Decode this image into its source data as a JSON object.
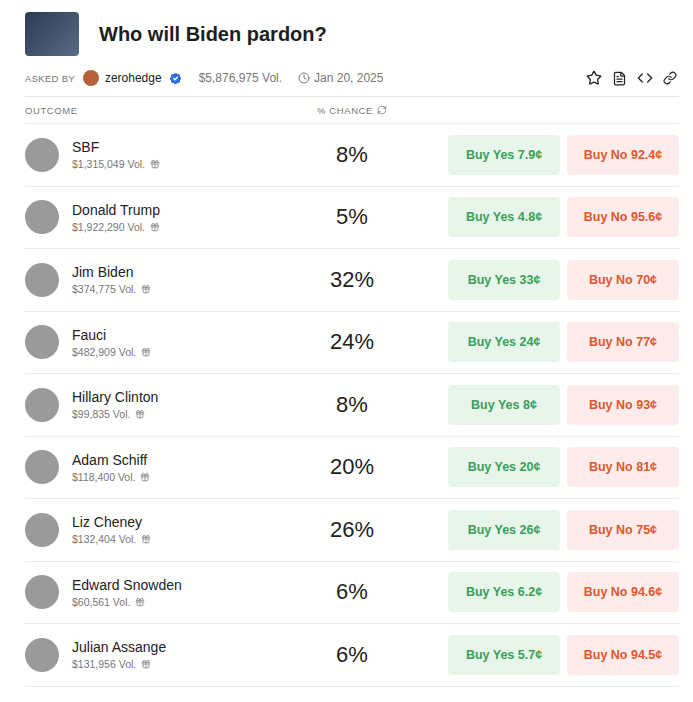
{
  "market": {
    "title": "Who will Biden pardon?",
    "asked_by_label": "ASKED BY",
    "author": "zerohedge",
    "verified": true,
    "volume": "$5,876,975 Vol.",
    "end_date": "Jan 20, 2025"
  },
  "columns": [
    "OUTCOME",
    "% CHANCE"
  ],
  "outcomes": [
    {
      "name": "SBF",
      "volume": "$1,315,049 Vol.",
      "chance": "8%",
      "yes": "Buy Yes 7.9¢",
      "no": "Buy No 92.4¢"
    },
    {
      "name": "Donald Trump",
      "volume": "$1,922,290 Vol.",
      "chance": "5%",
      "yes": "Buy Yes 4.8¢",
      "no": "Buy No 95.6¢"
    },
    {
      "name": "Jim Biden",
      "volume": "$374,775 Vol.",
      "chance": "32%",
      "yes": "Buy Yes 33¢",
      "no": "Buy No 70¢"
    },
    {
      "name": "Fauci",
      "volume": "$482,909 Vol.",
      "chance": "24%",
      "yes": "Buy Yes 24¢",
      "no": "Buy No 77¢"
    },
    {
      "name": "Hillary Clinton",
      "volume": "$99,835 Vol.",
      "chance": "8%",
      "yes": "Buy Yes 8¢",
      "no": "Buy No 93¢"
    },
    {
      "name": "Adam Schiff",
      "volume": "$118,400 Vol.",
      "chance": "20%",
      "yes": "Buy Yes 20¢",
      "no": "Buy No 81¢"
    },
    {
      "name": "Liz Cheney",
      "volume": "$132,404 Vol.",
      "chance": "26%",
      "yes": "Buy Yes 26¢",
      "no": "Buy No 75¢"
    },
    {
      "name": "Edward Snowden",
      "volume": "$60,561 Vol.",
      "chance": "6%",
      "yes": "Buy Yes 6.2¢",
      "no": "Buy No 94.6¢"
    },
    {
      "name": "Julian Assange",
      "volume": "$131,956 Vol.",
      "chance": "6%",
      "yes": "Buy Yes 5.7¢",
      "no": "Buy No 94.5¢"
    }
  ]
}
